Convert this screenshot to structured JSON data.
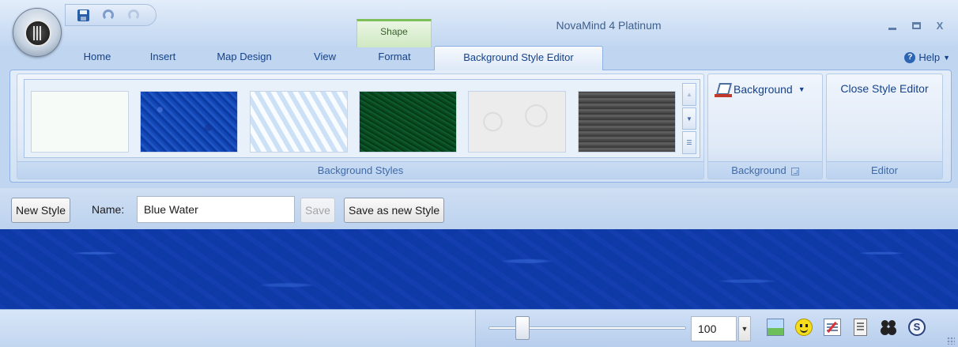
{
  "window": {
    "title": "NovaMind 4 Platinum",
    "controls": [
      "_",
      "□",
      "X"
    ]
  },
  "context_tab_group": "Shape",
  "tabs": [
    "Home",
    "Insert",
    "Map Design",
    "View",
    "Format",
    "Background Style Editor"
  ],
  "active_tab": "Background Style Editor",
  "help": {
    "label": "Help",
    "icon": "help-icon"
  },
  "ribbon": {
    "background_styles": {
      "label": "Background Styles",
      "swatches": [
        "white",
        "blue-water",
        "ice",
        "green",
        "paper-swirl",
        "stone"
      ]
    },
    "background": {
      "label": "Background",
      "button_label": "Background",
      "icon": "paint-bucket-icon"
    },
    "editor": {
      "label": "Editor",
      "button_label": "Close Style Editor"
    }
  },
  "editbar": {
    "new_style_label": "New Style",
    "name_label": "Name:",
    "name_value": "Blue Water",
    "save_label": "Save",
    "save_as_label": "Save as new Style"
  },
  "statusbar": {
    "zoom": "100",
    "zoom_slider_fraction": 0.17,
    "tray_icons": [
      "image-icon",
      "smiley-icon",
      "notes-icon",
      "document-icon",
      "people-icon",
      "s-icon"
    ]
  }
}
